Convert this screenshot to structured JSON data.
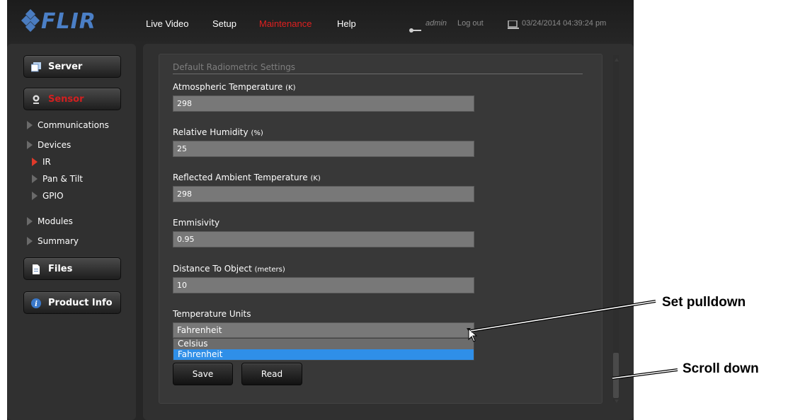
{
  "header": {
    "logo_text": "FLIR",
    "nav": [
      "Live Video",
      "Setup",
      "Maintenance",
      "Help"
    ],
    "active_nav": "Maintenance",
    "user": "admin",
    "logout_label": "Log out",
    "datetime": "03/24/2014 04:39:24 pm"
  },
  "sidebar": {
    "server_label": "Server",
    "sensor_label": "Sensor",
    "communications_label": "Communications",
    "devices_label": "Devices",
    "ir_label": "IR",
    "pan_tilt_label": "Pan & Tilt",
    "gpio_label": "GPIO",
    "modules_label": "Modules",
    "summary_label": "Summary",
    "files_label": "Files",
    "product_info_label": "Product Info"
  },
  "form": {
    "section_title": "Default Radiometric Settings",
    "fields": [
      {
        "label": "Atmospheric Temperature",
        "unit": "(K)",
        "value": "298"
      },
      {
        "label": "Relative Humidity",
        "unit": "(%)",
        "value": "25"
      },
      {
        "label": "Reflected Ambient Temperature",
        "unit": "(K)",
        "value": "298"
      },
      {
        "label": "Emmisivity",
        "unit": "",
        "value": "0.95"
      },
      {
        "label": "Distance To Object",
        "unit": "(meters)",
        "value": "10"
      }
    ],
    "units_label": "Temperature Units",
    "units_value": "Fahrenheit",
    "units_options": [
      "Celsius",
      "Fahrenheit"
    ],
    "units_highlighted": "Fahrenheit",
    "save_label": "Save",
    "read_label": "Read"
  },
  "annotations": {
    "pulldown": "Set pulldown",
    "scroll": "Scroll down"
  },
  "colors": {
    "brand_blue": "#4b7fc6",
    "active_red": "#e02020",
    "selection_blue": "#2f8fe8",
    "background": "#262626"
  }
}
